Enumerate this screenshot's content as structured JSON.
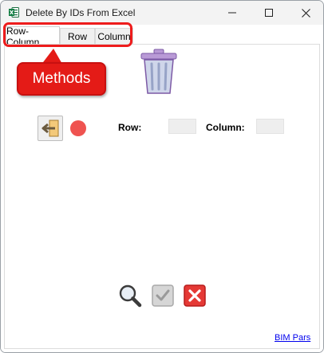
{
  "window": {
    "title": "Delete By IDs From Excel",
    "app_icon": "excel-icon",
    "controls": [
      "minimize-icon",
      "maximize-icon",
      "close-icon"
    ]
  },
  "tabs": [
    {
      "label": "Row-Column",
      "active": true
    },
    {
      "label": "Row",
      "active": false
    },
    {
      "label": "Column",
      "active": false
    }
  ],
  "annotation": {
    "callout_text": "Methods",
    "color": "#e41b17"
  },
  "main": {
    "trash_icon": "trash-icon",
    "import_icon": "import-arrow-icon",
    "status_color": "#ef5350",
    "row_label": "Row:",
    "row_value": "",
    "column_label": "Column:",
    "column_value": ""
  },
  "bottom": {
    "buttons": [
      "search-icon",
      "check-icon",
      "cancel-icon"
    ],
    "link_text": "BIM Pars"
  }
}
